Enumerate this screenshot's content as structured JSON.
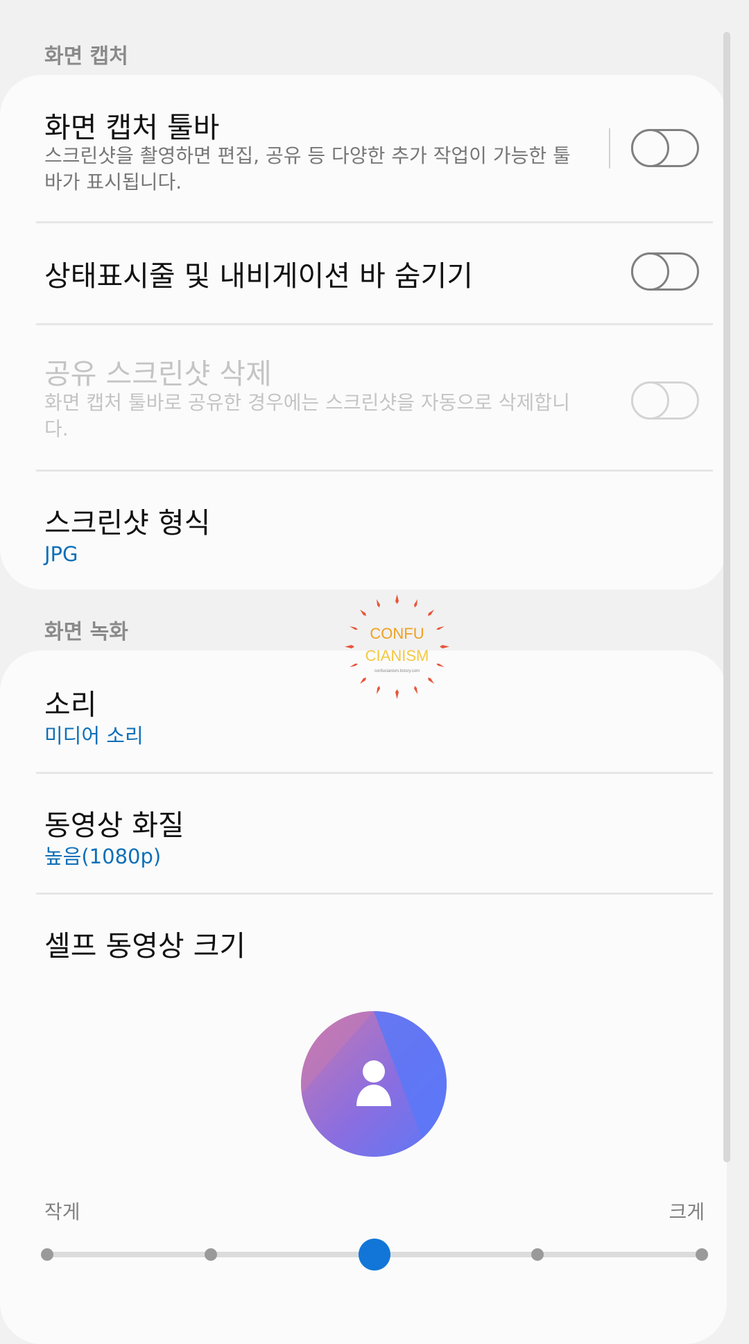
{
  "screen_capture": {
    "header": "화면 캡처",
    "toolbar": {
      "title": "화면 캡처 툴바",
      "desc": "스크린샷을 촬영하면 편집, 공유 등 다양한 추가 작업이 가능한 툴바가 표시됩니다.",
      "enabled": false
    },
    "hide_bars": {
      "title": "상태표시줄 및 내비게이션 바 숨기기",
      "enabled": false
    },
    "delete_shared": {
      "title": "공유 스크린샷 삭제",
      "desc": "화면 캡처 툴바로 공유한 경우에는 스크린샷을 자동으로 삭제합니다.",
      "enabled": false,
      "disabled": true
    },
    "format": {
      "title": "스크린샷 형식",
      "value": "JPG"
    }
  },
  "screen_recording": {
    "header": "화면 녹화",
    "sound": {
      "title": "소리",
      "value": "미디어 소리"
    },
    "quality": {
      "title": "동영상 화질",
      "value": "높음(1080p)"
    },
    "selfie_size": {
      "title": "셀프 동영상 크기",
      "min_label": "작게",
      "max_label": "크게",
      "steps": 5,
      "selected_step": 3
    }
  },
  "watermark": {
    "line1": "CONFU",
    "line2": "CIANISM",
    "small": "confucianism.tistory.com"
  },
  "colors": {
    "accent": "#1176d8",
    "value_text": "#0d6fb8",
    "avatar_gradient": [
      "#c77ab0",
      "#8a6ee0",
      "#5b78f8"
    ]
  },
  "icons": {
    "avatar": "person-icon"
  }
}
